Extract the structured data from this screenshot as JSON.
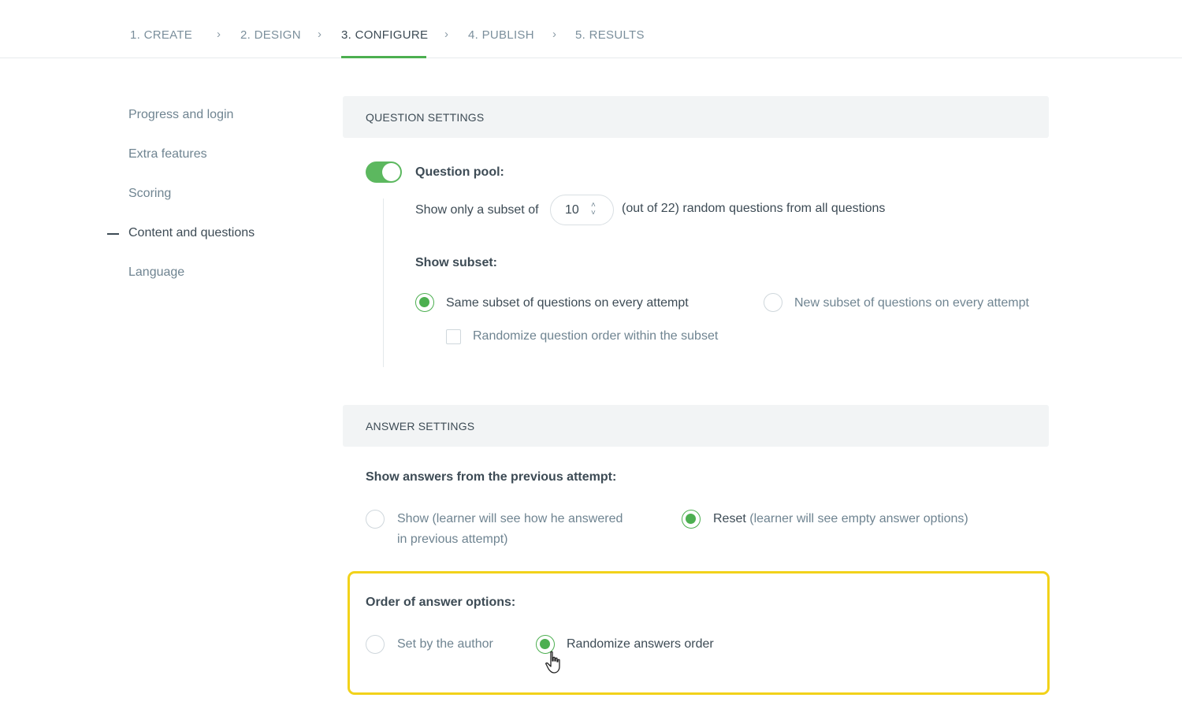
{
  "stepper": {
    "steps": [
      {
        "label": "1. CREATE"
      },
      {
        "label": "2. DESIGN"
      },
      {
        "label": "3. CONFIGURE"
      },
      {
        "label": "4. PUBLISH"
      },
      {
        "label": "5. RESULTS"
      }
    ],
    "separator": "›",
    "active_step": "3. CONFIGURE"
  },
  "sidebar": {
    "items": [
      {
        "label": "Progress and login"
      },
      {
        "label": "Extra features"
      },
      {
        "label": "Scoring"
      },
      {
        "label": "Content and questions"
      },
      {
        "label": "Language"
      }
    ],
    "active_item": "Content and questions"
  },
  "question_settings": {
    "header": "QUESTION SETTINGS",
    "pool_label": "Question pool:",
    "pool_enabled": true,
    "subset_prefix": "Show only a subset of",
    "subset_value": "10",
    "subset_suffix": "(out of 22) random questions from all questions",
    "show_subset_label": "Show subset:",
    "options": [
      {
        "label": "Same subset of questions on every attempt",
        "selected": true
      },
      {
        "label": "New subset of questions on every attempt",
        "selected": false
      }
    ],
    "randomize_label": "Randomize question order within the subset",
    "randomize_checked": false
  },
  "answer_settings": {
    "header": "ANSWER SETTINGS",
    "prev_attempt_label": "Show answers from the previous attempt:",
    "show_option_line1": "Show (learner will see how he answered",
    "show_option_line2": "in previous attempt)",
    "reset_option_strong": "Reset",
    "reset_option_rest": "(learner will see empty answer options)",
    "reset_selected": true,
    "order_label": "Order of answer options:",
    "order_options": [
      {
        "label": "Set by the author",
        "selected": false
      },
      {
        "label": "Randomize answers order",
        "selected": true
      }
    ]
  },
  "colors": {
    "accent": "#4caf50",
    "highlight": "#f2d21a"
  }
}
